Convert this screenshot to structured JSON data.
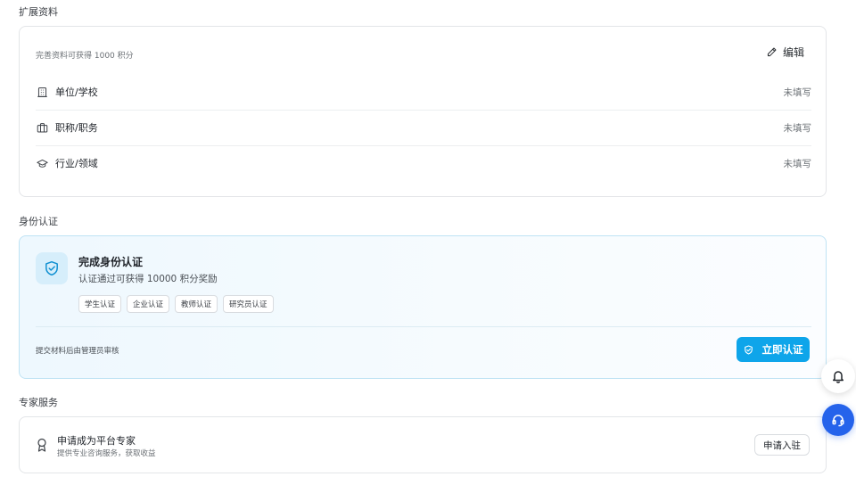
{
  "extended": {
    "section_title": "扩展资料",
    "hint": "完善资料可获得 1000 积分",
    "edit_label": "编辑",
    "rows": [
      {
        "label": "单位/学校",
        "value": "未填写",
        "icon": "building-icon"
      },
      {
        "label": "职称/职务",
        "value": "未填写",
        "icon": "briefcase-icon"
      },
      {
        "label": "行业/领域",
        "value": "未填写",
        "icon": "graduation-cap-icon"
      }
    ]
  },
  "verification": {
    "section_title": "身份认证",
    "title": "完成身份认证",
    "subtitle": "认证通过可获得 10000 积分奖励",
    "tags": [
      "学生认证",
      "企业认证",
      "教师认证",
      "研究员认证"
    ],
    "note": "提交材料后由管理员审核",
    "button_label": "立即认证",
    "accent_color": "#0ea5ea"
  },
  "expert": {
    "section_title": "专家服务",
    "title": "申请成为平台专家",
    "subtitle": "提供专业咨询服务，获取收益",
    "button_label": "申请入驻"
  },
  "floating": {
    "bell_icon": "bell-icon",
    "support_icon": "headset-icon",
    "support_color": "#2563eb"
  }
}
